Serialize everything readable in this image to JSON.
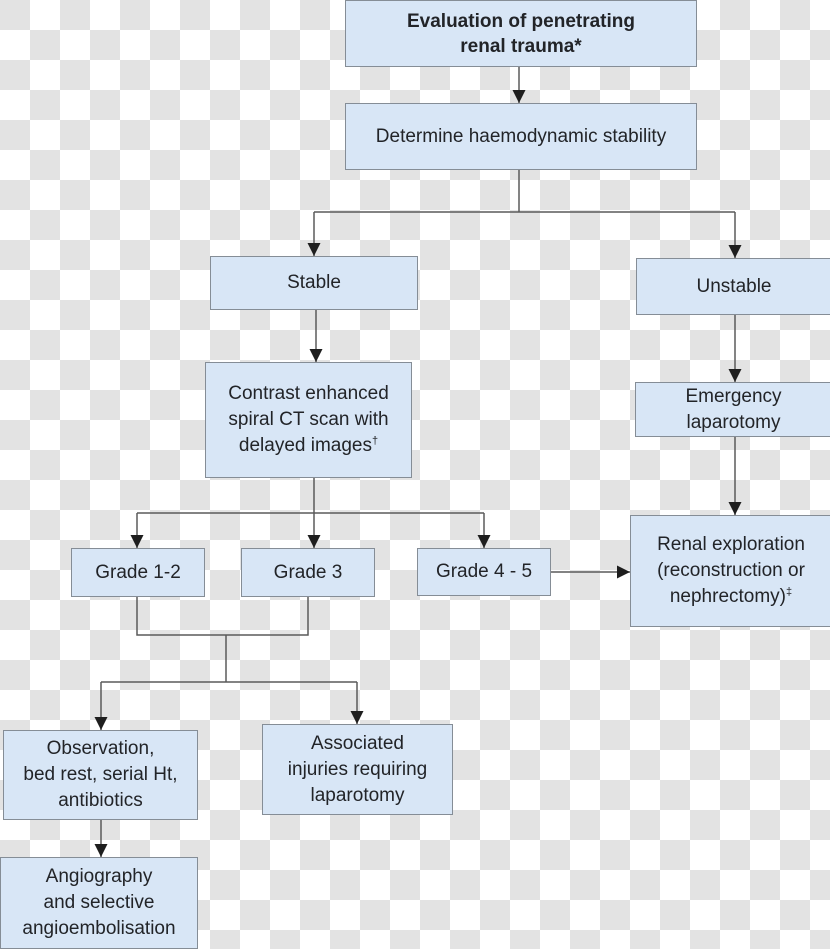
{
  "diagram": {
    "type": "flowchart",
    "title": "Evaluation of penetrating renal trauma",
    "colors": {
      "node_fill": "#d8e6f6",
      "node_border": "#858d96",
      "line": "#555555",
      "text": "#222428"
    },
    "nodes": {
      "title": {
        "text": "Evaluation of penetrating\nrenal trauma*"
      },
      "stability": {
        "text": "Determine haemodynamic stability"
      },
      "stable": {
        "text": "Stable"
      },
      "unstable": {
        "text": "Unstable"
      },
      "ct_scan": {
        "text": "Contrast enhanced\nspiral CT scan with\ndelayed images",
        "mark": "†"
      },
      "emergency": {
        "text": "Emergency\nlaparotomy"
      },
      "exploration": {
        "text": "Renal exploration\n(reconstruction or\nnephrectomy)",
        "mark": "‡"
      },
      "grade_1_2": {
        "text": "Grade 1-2"
      },
      "grade_3": {
        "text": "Grade 3"
      },
      "grade_4_5": {
        "text": "Grade 4 - 5"
      },
      "observation": {
        "text": "Observation,\nbed rest, serial Ht,\nantibiotics"
      },
      "associated": {
        "text": "Associated\ninjuries requiring\nlaparotomy"
      },
      "angiography": {
        "text": "Angiography\nand selective\nangioembolisation"
      }
    },
    "edges": [
      [
        "title",
        "stability"
      ],
      [
        "stability",
        "stable"
      ],
      [
        "stability",
        "unstable"
      ],
      [
        "stable",
        "ct_scan"
      ],
      [
        "unstable",
        "emergency"
      ],
      [
        "emergency",
        "exploration"
      ],
      [
        "ct_scan",
        "grade_1_2"
      ],
      [
        "ct_scan",
        "grade_3"
      ],
      [
        "ct_scan",
        "grade_4_5"
      ],
      [
        "grade_4_5",
        "exploration"
      ],
      [
        "grade_1_2",
        "observation"
      ],
      [
        "grade_3",
        "observation"
      ],
      [
        "grade_1_2",
        "associated"
      ],
      [
        "grade_3",
        "associated"
      ],
      [
        "observation",
        "angiography"
      ]
    ]
  }
}
